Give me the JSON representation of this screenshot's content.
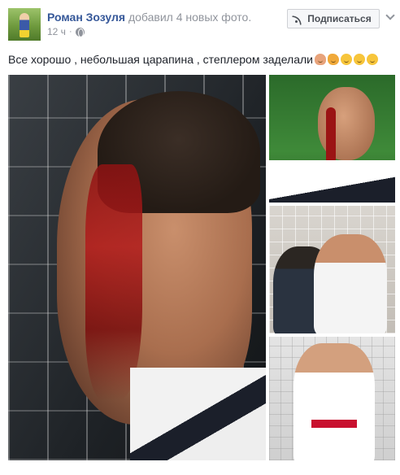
{
  "post": {
    "author_name": "Роман Зозуля",
    "action_text": "добавил 4 новых фото.",
    "timestamp": "12 ч",
    "dot": "·",
    "privacy_icon": "globe-icon",
    "subscribe_label": "Подписаться",
    "subscribe_icon": "rss-icon",
    "menu_icon": "chevron-down-icon",
    "text": "Все хорошо , небольшая царапина , степлером заделали",
    "emojis": [
      "person-emoji",
      "flexed-biceps-emoji",
      "slightly-smiling-emoji",
      "grinning-sweat-emoji",
      "sleepy-emoji"
    ]
  },
  "colors": {
    "link": "#365899",
    "muted": "#90949c",
    "text": "#1d2129",
    "button_bg": "#f6f7f9",
    "button_border": "#ced0d4"
  }
}
